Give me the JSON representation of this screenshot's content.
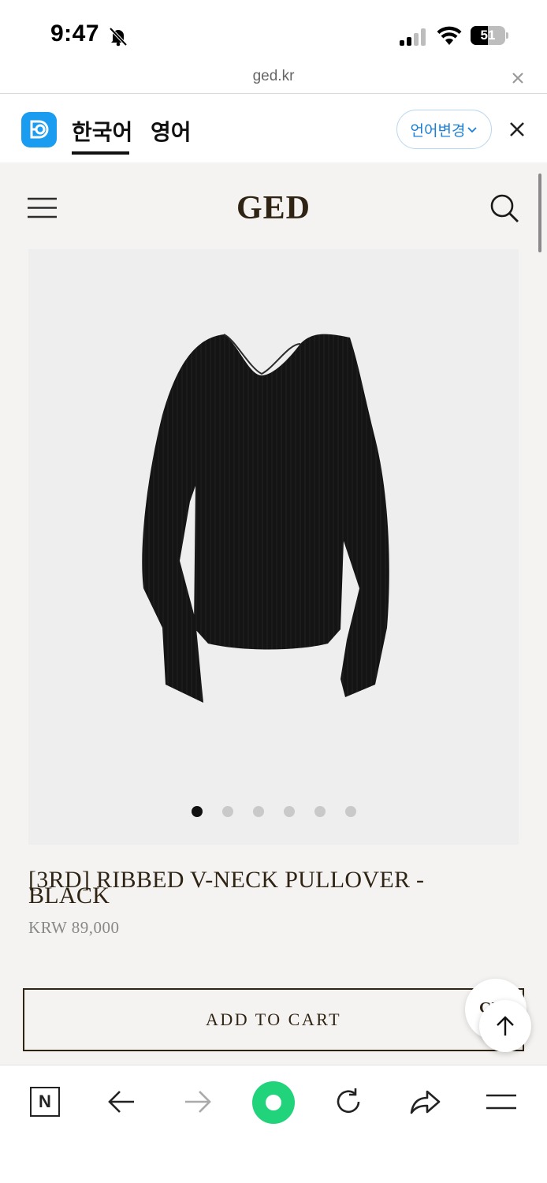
{
  "status_bar": {
    "time": "9:47",
    "battery_level": "51",
    "battery_percent": 51
  },
  "url_bar": {
    "domain": "ged.kr"
  },
  "translate_bar": {
    "active_language": "한국어",
    "other_language": "영어",
    "change_language_label": "언어변경",
    "accent_color": "#1a9cf0"
  },
  "site": {
    "logo": "GED"
  },
  "product": {
    "title": "[3RD] RIBBED V-NECK PULLOVER - BLACK",
    "price": "KRW 89,000",
    "image_count": 6,
    "active_image_index": 0
  },
  "actions": {
    "add_to_cart_label": "ADD TO CART",
    "chat_label": "GED"
  },
  "toolbar": {
    "items": [
      "home-icon",
      "back-arrow-icon",
      "forward-arrow-icon",
      "green-dot-icon",
      "reload-icon",
      "share-icon",
      "menu-icon"
    ]
  },
  "colors": {
    "brand_brown": "#2f2414",
    "page_background": "#f4f3f1",
    "green_button": "#21d37a"
  }
}
